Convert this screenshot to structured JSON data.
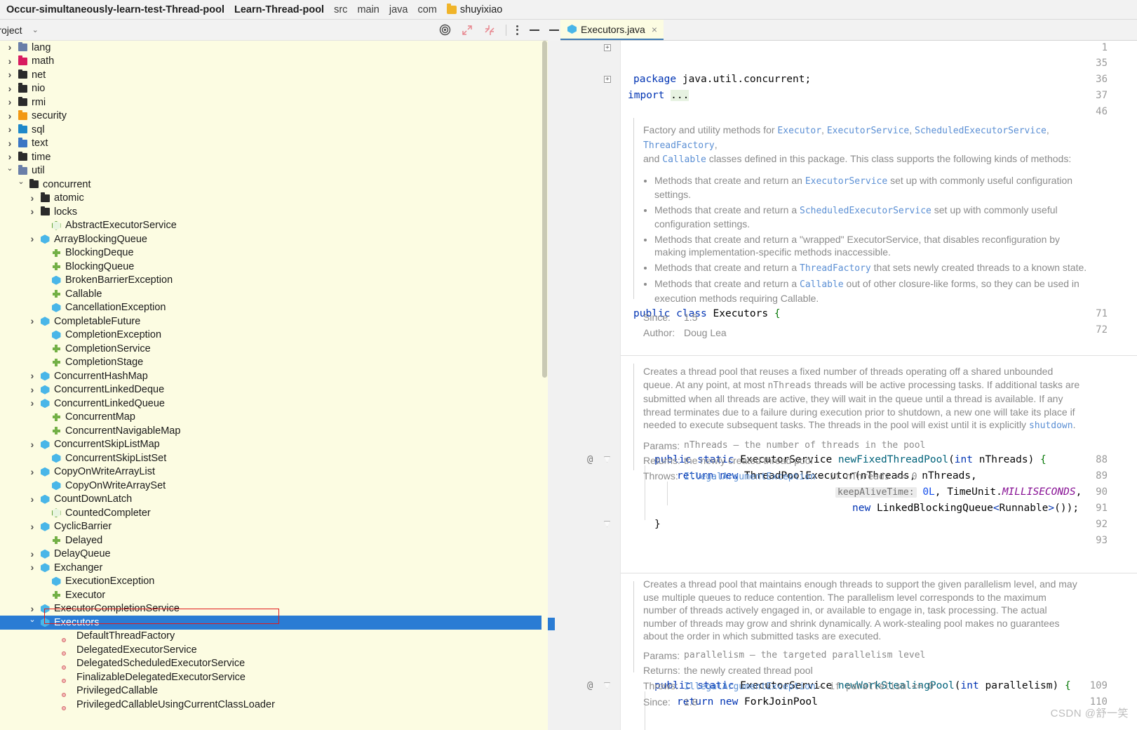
{
  "breadcrumb": {
    "items": [
      {
        "label": "Occur-simultaneously-learn-test-Thread-pool",
        "style": "bold"
      },
      {
        "label": "Learn-Thread-pool",
        "style": "bold"
      },
      {
        "label": "src",
        "style": "plain"
      },
      {
        "label": "main",
        "style": "plain"
      },
      {
        "label": "java",
        "style": "plain"
      },
      {
        "label": "com",
        "style": "plain"
      },
      {
        "label": "shuyixiao",
        "style": "folder"
      }
    ]
  },
  "tool_window": {
    "title": "Project",
    "actions": [
      "target-icon",
      "expand-all-icon",
      "collapse-all-icon",
      "more-options-icon",
      "hide-icon"
    ]
  },
  "tree": {
    "items": [
      {
        "label": "lang",
        "indent": 1,
        "arrow": "closed",
        "icon": "folder-steel"
      },
      {
        "label": "math",
        "indent": 1,
        "arrow": "closed",
        "icon": "folder-pink"
      },
      {
        "label": "net",
        "indent": 1,
        "arrow": "closed",
        "icon": "folder-black"
      },
      {
        "label": "nio",
        "indent": 1,
        "arrow": "closed",
        "icon": "folder-black"
      },
      {
        "label": "rmi",
        "indent": 1,
        "arrow": "closed",
        "icon": "folder-black"
      },
      {
        "label": "security",
        "indent": 1,
        "arrow": "closed",
        "icon": "folder-orange"
      },
      {
        "label": "sql",
        "indent": 1,
        "arrow": "closed",
        "icon": "folder-cyan"
      },
      {
        "label": "text",
        "indent": 1,
        "arrow": "closed",
        "icon": "folder-blue"
      },
      {
        "label": "time",
        "indent": 1,
        "arrow": "closed",
        "icon": "folder-black"
      },
      {
        "label": "util",
        "indent": 1,
        "arrow": "open",
        "icon": "folder-steel"
      },
      {
        "label": "concurrent",
        "indent": 2,
        "arrow": "open",
        "icon": "folder-black"
      },
      {
        "label": "atomic",
        "indent": 3,
        "arrow": "closed",
        "icon": "folder-black"
      },
      {
        "label": "locks",
        "indent": 3,
        "arrow": "closed",
        "icon": "folder-black"
      },
      {
        "label": "AbstractExecutorService",
        "indent": 4,
        "arrow": "none",
        "icon": "abstract-class"
      },
      {
        "label": "ArrayBlockingQueue",
        "indent": 3,
        "arrow": "closed",
        "icon": "class"
      },
      {
        "label": "BlockingDeque",
        "indent": 4,
        "arrow": "none",
        "icon": "interface"
      },
      {
        "label": "BlockingQueue",
        "indent": 4,
        "arrow": "none",
        "icon": "interface"
      },
      {
        "label": "BrokenBarrierException",
        "indent": 4,
        "arrow": "none",
        "icon": "class"
      },
      {
        "label": "Callable",
        "indent": 4,
        "arrow": "none",
        "icon": "interface"
      },
      {
        "label": "CancellationException",
        "indent": 4,
        "arrow": "none",
        "icon": "class"
      },
      {
        "label": "CompletableFuture",
        "indent": 3,
        "arrow": "closed",
        "icon": "class"
      },
      {
        "label": "CompletionException",
        "indent": 4,
        "arrow": "none",
        "icon": "class"
      },
      {
        "label": "CompletionService",
        "indent": 4,
        "arrow": "none",
        "icon": "interface"
      },
      {
        "label": "CompletionStage",
        "indent": 4,
        "arrow": "none",
        "icon": "interface"
      },
      {
        "label": "ConcurrentHashMap",
        "indent": 3,
        "arrow": "closed",
        "icon": "class"
      },
      {
        "label": "ConcurrentLinkedDeque",
        "indent": 3,
        "arrow": "closed",
        "icon": "class"
      },
      {
        "label": "ConcurrentLinkedQueue",
        "indent": 3,
        "arrow": "closed",
        "icon": "class"
      },
      {
        "label": "ConcurrentMap",
        "indent": 4,
        "arrow": "none",
        "icon": "interface"
      },
      {
        "label": "ConcurrentNavigableMap",
        "indent": 4,
        "arrow": "none",
        "icon": "interface"
      },
      {
        "label": "ConcurrentSkipListMap",
        "indent": 3,
        "arrow": "closed",
        "icon": "class"
      },
      {
        "label": "ConcurrentSkipListSet",
        "indent": 4,
        "arrow": "none",
        "icon": "class"
      },
      {
        "label": "CopyOnWriteArrayList",
        "indent": 3,
        "arrow": "closed",
        "icon": "class"
      },
      {
        "label": "CopyOnWriteArraySet",
        "indent": 4,
        "arrow": "none",
        "icon": "class"
      },
      {
        "label": "CountDownLatch",
        "indent": 3,
        "arrow": "closed",
        "icon": "class"
      },
      {
        "label": "CountedCompleter",
        "indent": 4,
        "arrow": "none",
        "icon": "abstract-class"
      },
      {
        "label": "CyclicBarrier",
        "indent": 3,
        "arrow": "closed",
        "icon": "class"
      },
      {
        "label": "Delayed",
        "indent": 4,
        "arrow": "none",
        "icon": "interface"
      },
      {
        "label": "DelayQueue",
        "indent": 3,
        "arrow": "closed",
        "icon": "class"
      },
      {
        "label": "Exchanger",
        "indent": 3,
        "arrow": "closed",
        "icon": "class"
      },
      {
        "label": "ExecutionException",
        "indent": 4,
        "arrow": "none",
        "icon": "class"
      },
      {
        "label": "Executor",
        "indent": 4,
        "arrow": "none",
        "icon": "interface"
      },
      {
        "label": "ExecutorCompletionService",
        "indent": 3,
        "arrow": "closed",
        "icon": "class"
      },
      {
        "label": "Executors",
        "indent": 3,
        "arrow": "open",
        "icon": "class",
        "selected": true
      },
      {
        "label": "DefaultThreadFactory",
        "indent": 5,
        "arrow": "none",
        "icon": "inner-class"
      },
      {
        "label": "DelegatedExecutorService",
        "indent": 5,
        "arrow": "none",
        "icon": "inner-class"
      },
      {
        "label": "DelegatedScheduledExecutorService",
        "indent": 5,
        "arrow": "none",
        "icon": "inner-class"
      },
      {
        "label": "FinalizableDelegatedExecutorService",
        "indent": 5,
        "arrow": "none",
        "icon": "inner-class"
      },
      {
        "label": "PrivilegedCallable",
        "indent": 5,
        "arrow": "none",
        "icon": "inner-class"
      },
      {
        "label": "PrivilegedCallableUsingCurrentClassLoader",
        "indent": 5,
        "arrow": "none",
        "icon": "inner-class"
      }
    ]
  },
  "editor": {
    "tab": {
      "label": "Executors.java",
      "icon": "java-class-icon",
      "close": "×"
    },
    "line_numbers": [
      "1",
      "35",
      "36",
      "37",
      "46",
      "71",
      "72",
      "88",
      "89",
      "90",
      "91",
      "92",
      "93",
      "109",
      "110"
    ],
    "gutter_marks": {
      "88": "@",
      "109": "@"
    },
    "folded_comment": "/.../",
    "code": {
      "package_kw": "package",
      "package_name": "java.util.concurrent;",
      "import_kw": "import",
      "import_folded": "...",
      "class_decl": {
        "public": "public",
        "class": "class",
        "name": "Executors",
        "brace": "{"
      },
      "fixed_pool": {
        "l88": "public static ExecutorService newFixedThreadPool(int nThreads) {",
        "l89": "return new ThreadPoolExecutor(nThreads, nThreads,",
        "l90_hint": "keepAliveTime:",
        "l90": "0L, TimeUnit.MILLISECONDS,",
        "l91": "new LinkedBlockingQueue<Runnable>());",
        "l92": "}"
      },
      "work_stealing": {
        "l109": "public static ExecutorService newWorkStealingPool(int parallelism) {",
        "l110": "return new ForkJoinPool"
      }
    },
    "javadoc_class": {
      "intro_1": "Factory and utility methods for ",
      "links": [
        "Executor",
        "ExecutorService",
        "ScheduledExecutorService",
        "ThreadFactory"
      ],
      "intro_2": "and ",
      "callable": "Callable",
      "intro_3": " classes defined in this package. This class supports the following kinds of methods:",
      "bullets": [
        {
          "pre": "Methods that create and return an ",
          "link": "ExecutorService",
          "post": " set up with commonly useful configuration settings."
        },
        {
          "pre": "Methods that create and return a ",
          "link": "ScheduledExecutorService",
          "post": " set up with commonly useful configuration settings."
        },
        {
          "pre": "Methods that create and return a \"wrapped\" ExecutorService, that disables reconfiguration by making implementation-specific methods inaccessible.",
          "link": "",
          "post": ""
        },
        {
          "pre": "Methods that create and return a ",
          "link": "ThreadFactory",
          "post": " that sets newly created threads to a known state."
        },
        {
          "pre": "Methods that create and return a ",
          "link": "Callable",
          "post": " out of other closure-like forms, so they can be used in execution methods requiring Callable."
        }
      ],
      "since_label": "Since:",
      "since_value": "1.5",
      "author_label": "Author:",
      "author_value": "Doug Lea"
    },
    "javadoc_fixed": {
      "body": "Creates a thread pool that reuses a fixed number of threads operating off a shared unbounded queue. At any point, at most nThreads threads will be active processing tasks. If additional tasks are submitted when all threads are active, they will wait in the queue until a thread is available. If any thread terminates due to a failure during execution prior to shutdown, a new one will take its place if needed to execute subsequent tasks. The threads in the pool will exist until it is explicitly shutdown.",
      "params_label": "Params:",
      "params_value": "nThreads – the number of threads in the pool",
      "returns_label": "Returns:",
      "returns_value": "the newly created thread pool",
      "throws_label": "Throws:",
      "throws_link": "IllegalArgumentException",
      "throws_value": "– if nThreads <= 0"
    },
    "javadoc_stealing": {
      "body": "Creates a thread pool that maintains enough threads to support the given parallelism level, and may use multiple queues to reduce contention. The parallelism level corresponds to the maximum number of threads actively engaged in, or available to engage in, task processing. The actual number of threads may grow and shrink dynamically. A work-stealing pool makes no guarantees about the order in which submitted tasks are executed.",
      "params_label": "Params:",
      "params_value": "parallelism – the targeted parallelism level",
      "returns_label": "Returns:",
      "returns_value": "the newly created thread pool",
      "throws_label": "Throws:",
      "throws_link": "IllegalArgumentException",
      "throws_value": "– if parallelism <= 0",
      "since_label": "Since:",
      "since_value": "1.8"
    }
  },
  "watermark": "CSDN @舒一笑",
  "colors": {
    "tree_bg": "#fcfce2",
    "selection": "#2a7cd4",
    "annotation_red": "#e01b1b",
    "keyword_blue": "#0033b3"
  }
}
